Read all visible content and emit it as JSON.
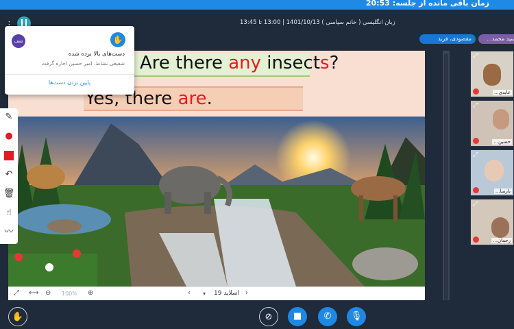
{
  "timer": {
    "text": "زمان باقی مانده از جلسه: 20:53"
  },
  "header": {
    "session_title": "زبان انگلیسی ( خانم سپاسی ) 1401/10/13 | 13:00 تا 13:45"
  },
  "participants_bar": {
    "chip_speaker": "مقصودی، فرید",
    "chip_other": "سید محمد..."
  },
  "slide": {
    "question_prefix": "Are there ",
    "question_mid": "any",
    "question_word": " insect",
    "question_s": "s",
    "question_end": "?",
    "answer_prefix": "Yes, there ",
    "answer_mid": "are",
    "answer_end": "."
  },
  "slide_toolbar": {
    "page_label": "اسلاید 19",
    "zoom_label": "100%"
  },
  "popup": {
    "avatar": "شف",
    "title": "دست‌های بالا برده شده",
    "subtitle": "شفیعی نشاط، امیر حسین اجازه گرفت",
    "action": "پایین بردن دست‌ها"
  },
  "videos": [
    {
      "name": "عابدی..."
    },
    {
      "name": "حسین..."
    },
    {
      "name": "بارسا..."
    },
    {
      "name": "رحمان..."
    }
  ],
  "colors": {
    "accent": "#1e88e5",
    "background": "#1f2a3a",
    "highlight_word": "#e31b23"
  }
}
